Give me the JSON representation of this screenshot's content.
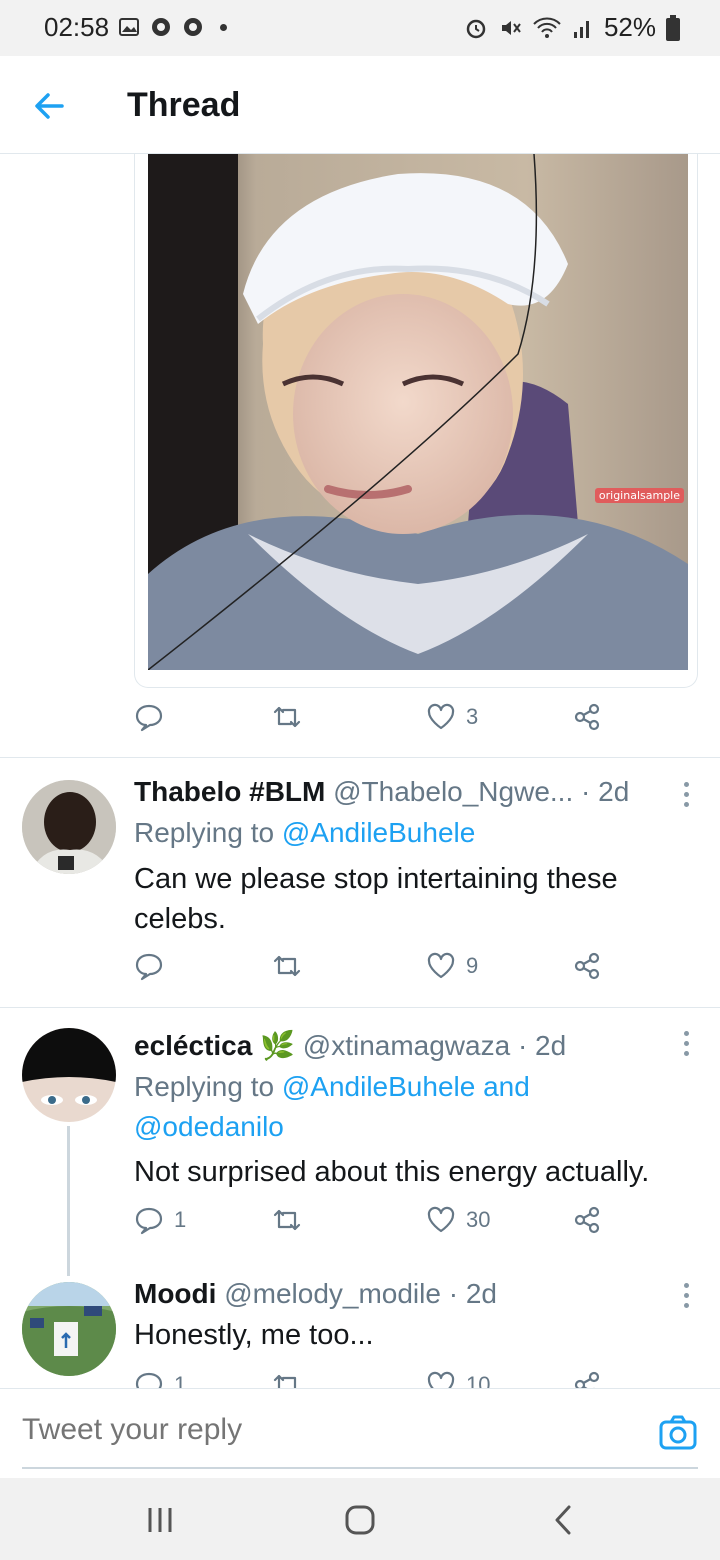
{
  "status_bar": {
    "time": "02:58",
    "battery": "52%"
  },
  "header": {
    "title": "Thread"
  },
  "media": {
    "watermark": "originalsample"
  },
  "main_tweet_actions": {
    "likes": "3"
  },
  "tweets": [
    {
      "name": "Thabelo #BLM",
      "handle": "@Thabelo_Ngwe...",
      "time": "· 2d",
      "reply_prefix": "Replying to ",
      "reply_to": "@AndileBuhele",
      "text": "Can we please stop intertaining these celebs.",
      "replies": "",
      "likes": "9"
    },
    {
      "name": "ecléctica",
      "emoji": "🌿",
      "handle": "@xtinamagwaza",
      "time": "· 2d",
      "reply_prefix": "Replying to ",
      "reply_to": "@AndileBuhele and",
      "reply_to_2": "@odedanilo",
      "text": "Not surprised about this energy actually.",
      "replies": "1",
      "likes": "30"
    },
    {
      "name": "Moodi",
      "handle": "@melody_modile",
      "time": "· 2d",
      "text": "Honestly, me too...",
      "replies": "1",
      "likes": "10"
    }
  ],
  "reply_bar": {
    "placeholder": "Tweet your reply"
  },
  "colors": {
    "accent": "#1da1f2",
    "muted": "#657786",
    "divider": "#e1e8ed"
  },
  "icons": [
    "back-arrow-icon",
    "reply-icon",
    "retweet-icon",
    "like-icon",
    "share-icon",
    "more-icon",
    "camera-icon",
    "recents-icon",
    "home-icon",
    "back-icon"
  ]
}
